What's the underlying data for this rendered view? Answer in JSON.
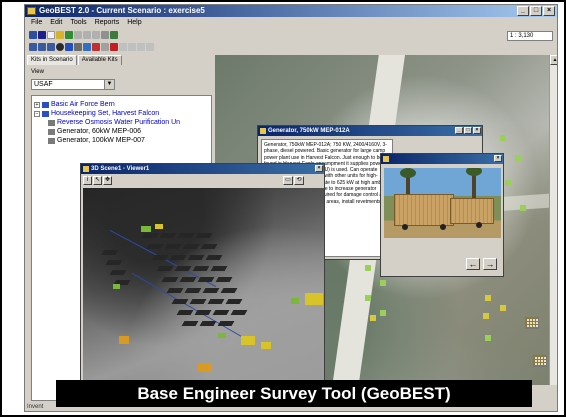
{
  "app": {
    "title": "GeoBEST 2.0 - Current Scenario : exercise5",
    "caption": "Base Engineer Survey Tool (GeoBEST)",
    "coord_readout": "1 : 3,130",
    "status_text": "Invent"
  },
  "window_buttons": {
    "minimize": "_",
    "maximize": "□",
    "close": "×"
  },
  "menu": [
    "File",
    "Edit",
    "Tools",
    "Reports",
    "Help"
  ],
  "left_panel": {
    "tabs": [
      "Kits in Scenario",
      "Available Kits"
    ],
    "view_label": "View",
    "view_value": "USAF",
    "tree": [
      {
        "label": "Basic Air Force Bern",
        "level": 0,
        "expander": "+"
      },
      {
        "label": "Housekeeping Set, Harvest Falcon",
        "level": 0,
        "expander": "−"
      },
      {
        "label": "Reverse Osmosis Water Purification Un",
        "level": 1,
        "selected": true
      },
      {
        "label": "Generator, 60kW MEP-006",
        "level": 1
      },
      {
        "label": "Generator, 100kW MEP-007",
        "level": 1
      }
    ]
  },
  "generator_window": {
    "title": "Generator, 750kW MEP-012A",
    "description": "Generator, 750kW MEP-012A; 750 KW, 2400/4160V, 3-phase, diesel powered. Basic generator for large camp power plant use in Harvest Falcon. Just enough to be found in Harvest Eagle encampment it supplies power to the primary distribution (PRU) is used. Can operate alone, or can be paralleled with other units for high-capacity power plants. Derate to 625 kW at high ambient temperatures; provide shade to increase generator efficiency. Hardening is required for damage control and survivability. For high-threat areas, install revetments around the system."
  },
  "photo_window": {
    "prev_label": "←",
    "next_label": "→"
  },
  "scene_window": {
    "title": "3D Scene1 - Viewer1"
  },
  "colors": {
    "title_gradient_start": "#0a246a",
    "caption_bg": "#000000",
    "caption_fg": "#ffffff",
    "tree_link": "#0000c8"
  }
}
